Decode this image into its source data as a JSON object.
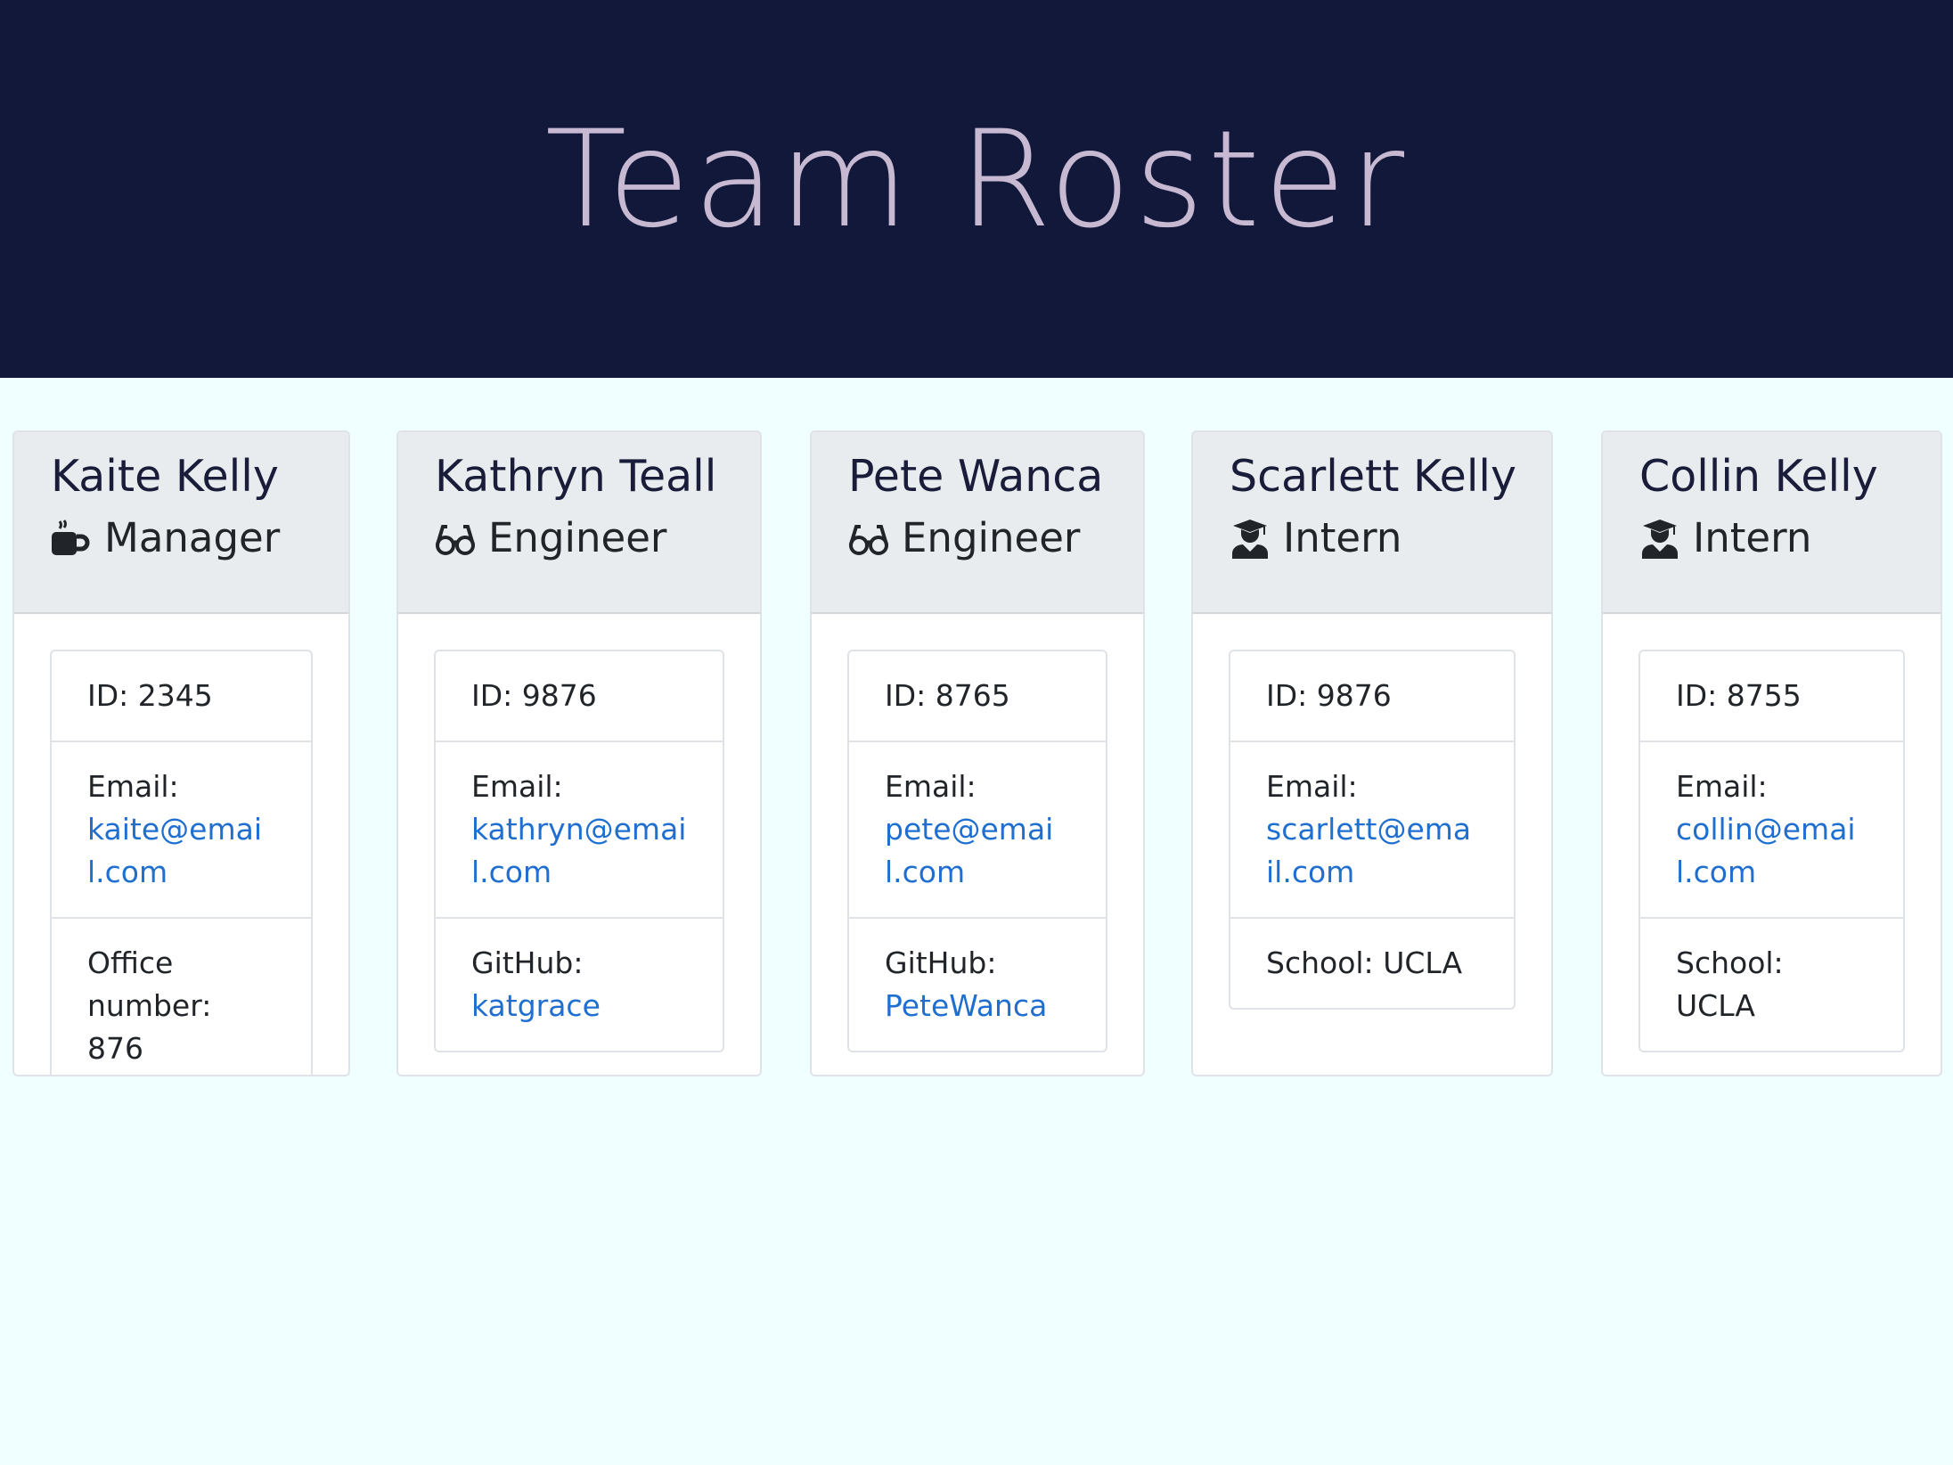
{
  "header": {
    "title": "Team Roster"
  },
  "employees": [
    {
      "name": "Kaite Kelly",
      "role": "Manager",
      "icon": "coffee-icon",
      "id_text": "ID: 2345",
      "email_label": "Email:",
      "email": "kaite@email.com",
      "extra_label": "Office number:",
      "extra_value": "876"
    },
    {
      "name": "Kathryn Teall",
      "role": "Engineer",
      "icon": "glasses-icon",
      "id_text": "ID: 9876",
      "email_label": "Email:",
      "email": "kathryn@email.com",
      "extra_label": "GitHub:",
      "extra_value": "katgrace"
    },
    {
      "name": "Pete Wanca",
      "role": "Engineer",
      "icon": "glasses-icon",
      "id_text": "ID: 8765",
      "email_label": "Email:",
      "email": "pete@email.com",
      "extra_label": "GitHub:",
      "extra_value": "PeteWanca"
    },
    {
      "name": "Scarlett Kelly",
      "role": "Intern",
      "icon": "graduate-icon",
      "id_text": "ID: 9876",
      "email_label": "Email:",
      "email": "scarlett@email.com",
      "extra_label": "School:",
      "extra_value": "UCLA"
    },
    {
      "name": "Collin Kelly",
      "role": "Intern",
      "icon": "graduate-icon",
      "id_text": "ID: 8755",
      "email_label": "Email:",
      "email": "collin@email.com",
      "extra_label": "School:",
      "extra_value": "UCLA"
    }
  ],
  "colors": {
    "header_bg": "#11183a",
    "title": "#c8b9d3",
    "link": "#1f6fd1",
    "page_bg": "#f0ffff"
  }
}
